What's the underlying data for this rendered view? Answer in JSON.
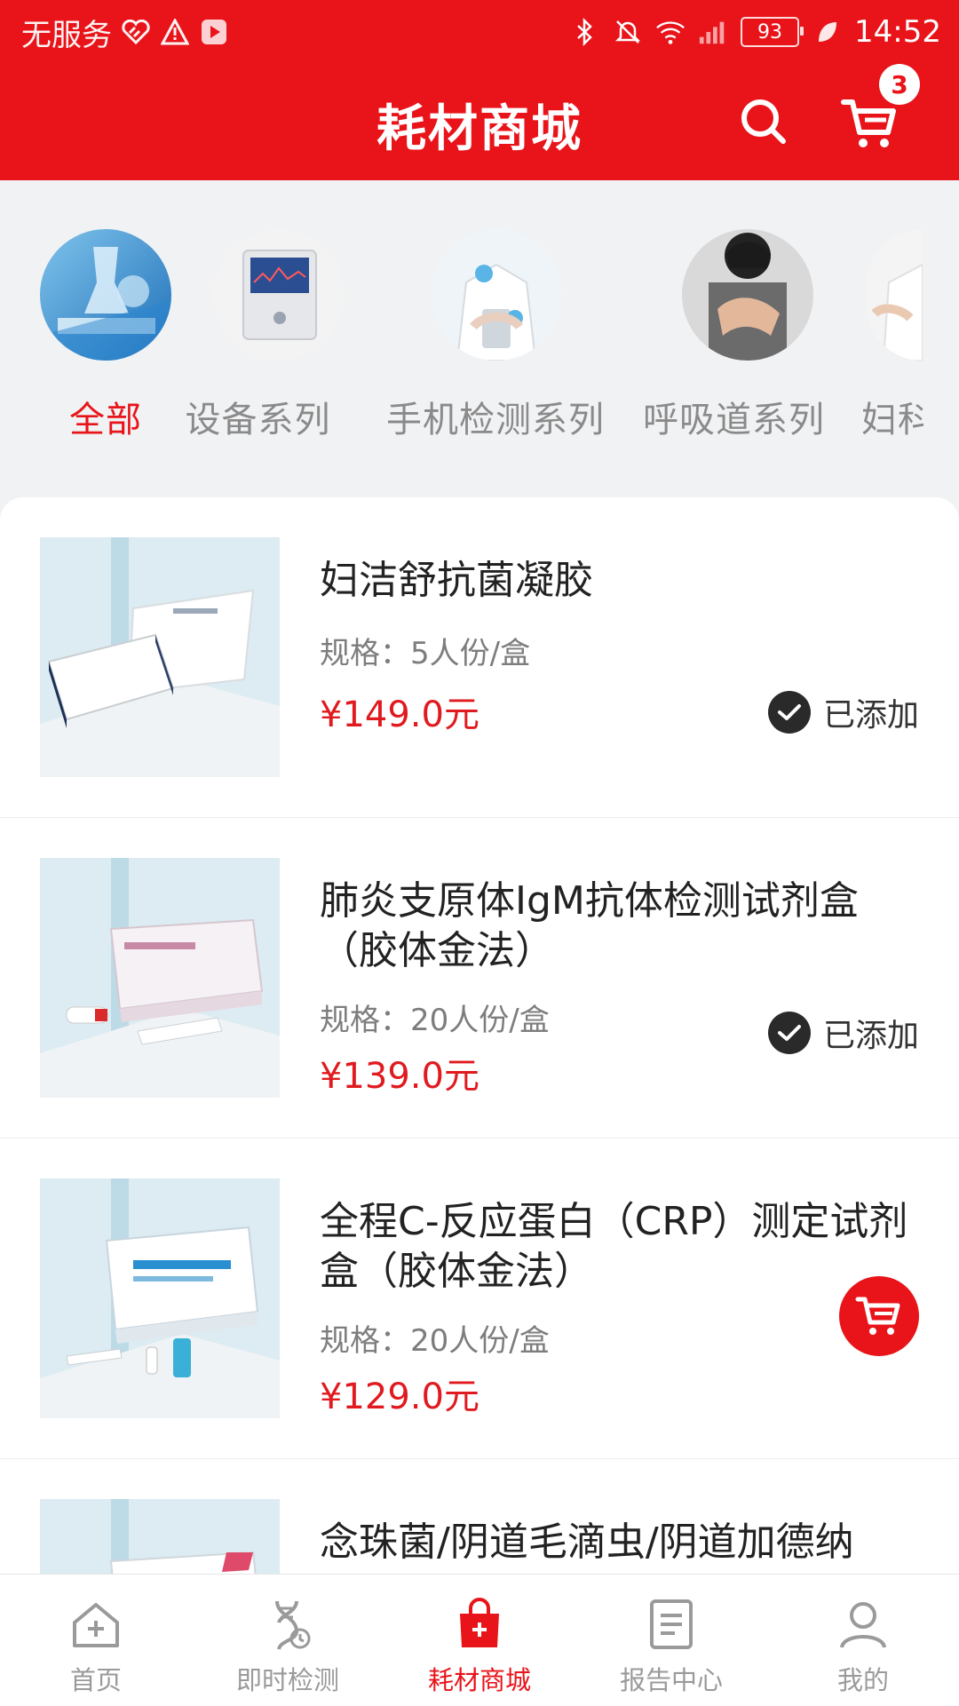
{
  "status_bar": {
    "carrier": "无服务",
    "battery": "93",
    "time": "14:52"
  },
  "header": {
    "title": "耗材商城",
    "cart_count": "3"
  },
  "categories": [
    {
      "label": "全部",
      "active": true
    },
    {
      "label": "设备系列"
    },
    {
      "label": "手机检测系列"
    },
    {
      "label": "呼吸道系列"
    },
    {
      "label": "妇科"
    }
  ],
  "products": [
    {
      "name": "妇洁舒抗菌凝胶",
      "spec": "规格：5人份/盒",
      "price": "¥149.0元",
      "status": "已添加"
    },
    {
      "name": "肺炎支原体IgM抗体检测试剂盒（胶体金法）",
      "spec": "规格：20人份/盒",
      "price": "¥139.0元",
      "status": "已添加"
    },
    {
      "name": "全程C-反应蛋白（CRP）测定试剂盒（胶体金法）",
      "spec": "规格：20人份/盒",
      "price": "¥129.0元"
    },
    {
      "name": "念珠菌/阴道毛滴虫/阴道加德纳"
    }
  ],
  "nav": [
    {
      "label": "首页",
      "icon": "home-icon"
    },
    {
      "label": "即时检测",
      "icon": "dna-icon"
    },
    {
      "label": "耗材商城",
      "icon": "shopping-bag-icon",
      "active": true
    },
    {
      "label": "报告中心",
      "icon": "report-icon"
    },
    {
      "label": "我的",
      "icon": "user-icon"
    }
  ],
  "colors": {
    "brand": "#e8141a",
    "price": "#e01a1f",
    "background": "#f1f2f4"
  }
}
